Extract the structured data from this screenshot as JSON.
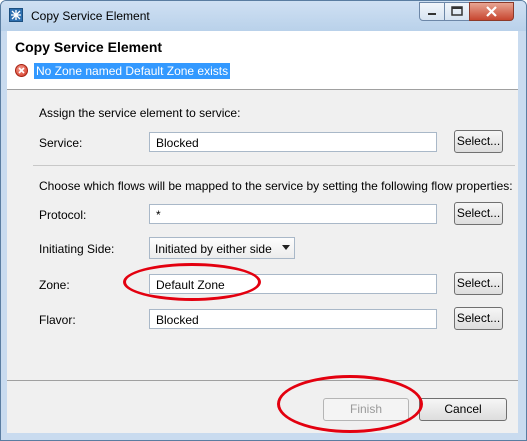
{
  "window": {
    "title": "Copy Service Element"
  },
  "header": {
    "title": "Copy Service Element",
    "error_message": "No Zone named Default Zone exists"
  },
  "service_section": {
    "heading": "Assign the service element to service:",
    "service_label": "Service:",
    "service_value": "Blocked",
    "select_label": "Select..."
  },
  "flow_section": {
    "heading": "Choose which flows will be mapped to the service by setting the following flow properties:",
    "protocol_label": "Protocol:",
    "protocol_value": "*",
    "initiating_label": "Initiating Side:",
    "initiating_value": "Initiated by either side",
    "zone_label": "Zone:",
    "zone_value": "Default Zone",
    "flavor_label": "Flavor:",
    "flavor_value": "Blocked",
    "select_label": "Select..."
  },
  "footer": {
    "finish_label": "Finish",
    "cancel_label": "Cancel"
  },
  "colors": {
    "error_highlight": "#3399ff",
    "annotation": "#e3000f"
  }
}
